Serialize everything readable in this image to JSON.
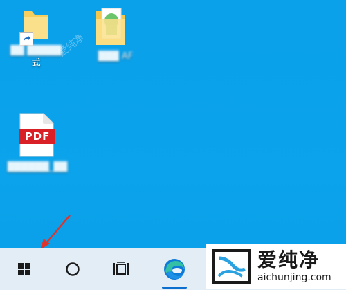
{
  "desktop": {
    "icons": [
      {
        "id": "shortcut-app",
        "label": "式",
        "label_blurred": "██ █████",
        "type": "shortcut-folder"
      },
      {
        "id": "image-folder",
        "label_blurred": "███ AF",
        "type": "folder"
      },
      {
        "id": "pdf-file",
        "badge": "PDF",
        "label_blurred": "██████_██",
        "type": "pdf-document"
      }
    ],
    "faint_watermark": "爱纯净"
  },
  "taskbar": {
    "items": [
      {
        "name": "start-button",
        "icon": "windows-logo-icon"
      },
      {
        "name": "search-button",
        "icon": "search-circle-icon"
      },
      {
        "name": "task-view-button",
        "icon": "task-view-icon"
      },
      {
        "name": "edge-button",
        "icon": "edge-icon"
      }
    ]
  },
  "watermark": {
    "chinese": "爱纯净",
    "url": "aichunjing.com"
  },
  "annotation": {
    "color": "#e0332a",
    "shape": "arrow"
  },
  "colors": {
    "desktop_blue": "#0aa0ea",
    "taskbar_bg": "#ebf0f6",
    "pdf_red": "#d92027"
  }
}
